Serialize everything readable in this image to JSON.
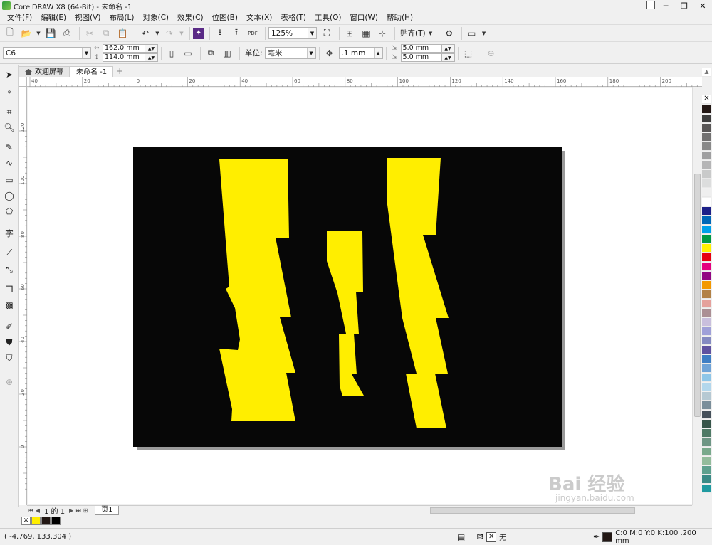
{
  "window": {
    "title": "CorelDRAW X8 (64-Bit) - 未命名 -1"
  },
  "menu": [
    "文件(F)",
    "编辑(E)",
    "视图(V)",
    "布局(L)",
    "对象(C)",
    "效果(C)",
    "位图(B)",
    "文本(X)",
    "表格(T)",
    "工具(O)",
    "窗口(W)",
    "帮助(H)"
  ],
  "toolbar": {
    "zoom": "125%",
    "snap_label": "贴齐(T)",
    "pdf_label": "PDF"
  },
  "property_bar": {
    "preset": "C6",
    "width": "162.0 mm",
    "height": "114.0 mm",
    "units_label": "单位:",
    "units": "毫米",
    "nudge": ".1 mm",
    "dup_x": "5.0 mm",
    "dup_y": "5.0 mm"
  },
  "doc_tabs": [
    {
      "label": "欢迎屏幕",
      "active": false
    },
    {
      "label": "未命名 -1",
      "active": true
    }
  ],
  "ruler": {
    "h_labels": [
      "40",
      "20",
      "0",
      "20",
      "40",
      "60",
      "80",
      "100",
      "120",
      "140",
      "160",
      "180",
      "200"
    ],
    "v_labels": [
      "120",
      "100",
      "80",
      "60",
      "40",
      "20",
      "0"
    ],
    "unit": "毫米"
  },
  "page_nav": {
    "position": "1 的 1",
    "page_tab": "页1"
  },
  "status": {
    "coords": "( -4.769, 133.304 )",
    "fill_label": "无",
    "outline_info": "C:0 M:0 Y:0 K:100 .200 mm"
  },
  "colors": {
    "page_bg": "#070707",
    "bolt": "#FFEE00",
    "canvas": "#ffffff"
  },
  "palette": [
    "#231815",
    "#3e3e3e",
    "#595757",
    "#727171",
    "#898989",
    "#9f9fa0",
    "#b5b5b6",
    "#c9caca",
    "#dcdddd",
    "#efefef",
    "#ffffff",
    "#1d2088",
    "#0068b7",
    "#00a0e9",
    "#009944",
    "#fff100",
    "#e60012",
    "#e4007f",
    "#920783",
    "#f39800",
    "#b28146",
    "#e5a19c",
    "#ab8f94",
    "#c9bfdd",
    "#9fa0d8",
    "#848ac1",
    "#5f52a0",
    "#3e7ec4",
    "#6fa3d7",
    "#8ec6e8",
    "#b3d7ec",
    "#b6c9d3",
    "#7a8e9a",
    "#45505a",
    "#37554a",
    "#4f7a66",
    "#6e9685",
    "#79a98c",
    "#93bc9c",
    "#5ea08e",
    "#3a8a86",
    "#1f9aa0"
  ],
  "doc_palette": [
    "#FFEE00",
    "#231815",
    "#000000"
  ],
  "watermark": {
    "text": "Bai 经验",
    "sub": "jingyan.baidu.com"
  }
}
